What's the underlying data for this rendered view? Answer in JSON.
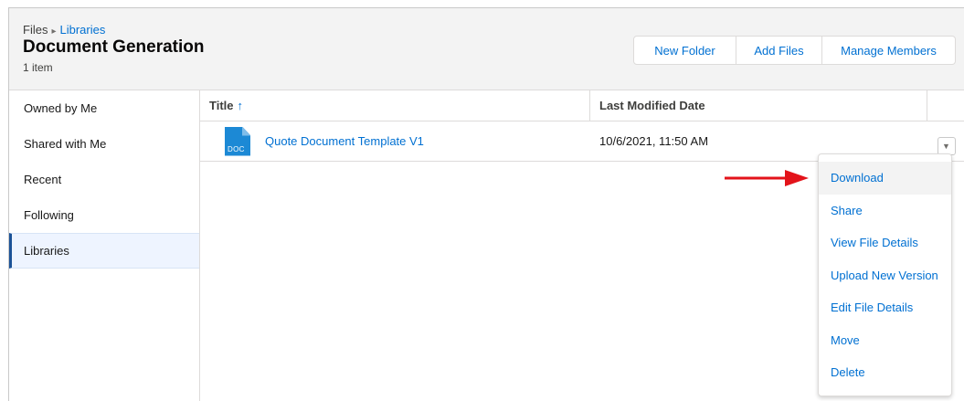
{
  "header": {
    "breadcrumb_root": "Files",
    "breadcrumb_current": "Libraries",
    "title": "Document Generation",
    "item_count": "1 item",
    "buttons": {
      "new_folder": "New Folder",
      "add_files": "Add Files",
      "manage_members": "Manage Members"
    }
  },
  "sidebar": {
    "items": [
      {
        "label": "Owned by Me"
      },
      {
        "label": "Shared with Me"
      },
      {
        "label": "Recent"
      },
      {
        "label": "Following"
      },
      {
        "label": "Libraries",
        "active": true
      }
    ]
  },
  "table": {
    "columns": {
      "title": "Title",
      "sort_indicator": "↑",
      "last_modified": "Last Modified Date"
    },
    "rows": [
      {
        "icon_label": "DOC",
        "title": "Quote Document Template V1",
        "last_modified": "10/6/2021, 11:50 AM"
      }
    ]
  },
  "row_menu": {
    "trigger_icon": "▼",
    "items": [
      {
        "label": "Download",
        "highlighted": true
      },
      {
        "label": "Share"
      },
      {
        "label": "View File Details"
      },
      {
        "label": "Upload New Version"
      },
      {
        "label": "Edit File Details"
      },
      {
        "label": "Move"
      },
      {
        "label": "Delete"
      }
    ]
  },
  "colors": {
    "link": "#0070d2",
    "header_bg": "#f3f3f3",
    "active_nav_border": "#1b5297",
    "doc_icon": "#1c89d5",
    "annotation_arrow": "#e3131a"
  }
}
